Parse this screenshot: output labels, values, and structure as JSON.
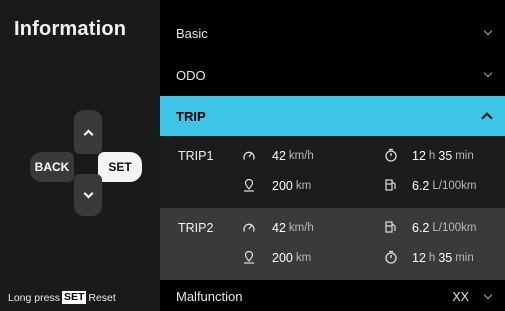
{
  "left": {
    "title": "Information",
    "buttons": {
      "back": "BACK",
      "set": "SET"
    },
    "hint": {
      "prefix": "Long press",
      "key": "SET",
      "suffix": "Reset"
    }
  },
  "menu": {
    "basic": "Basic",
    "odo": "ODO",
    "trip": "TRIP",
    "malfunction": "Malfunction",
    "malfunction_value": "XX"
  },
  "trip1": {
    "name": "TRIP1",
    "speed": {
      "value": "42",
      "unit": "km/h"
    },
    "time": {
      "h": "12",
      "h_unit": "h",
      "m": "35",
      "m_unit": "min"
    },
    "distance": {
      "value": "200",
      "unit": "km"
    },
    "fuel": {
      "value": "6.2",
      "unit": "L/100km"
    }
  },
  "trip2": {
    "name": "TRIP2",
    "speed": {
      "value": "42",
      "unit": "km/h"
    },
    "fuel": {
      "value": "6.2",
      "unit": "L/100km"
    },
    "distance": {
      "value": "200",
      "unit": "km"
    },
    "time": {
      "h": "12",
      "h_unit": "h",
      "m": "35",
      "m_unit": "min"
    }
  },
  "colors": {
    "accent": "#3ec4e6",
    "panel": "#1a1a1a",
    "trip2_bg": "#3a3a3a"
  }
}
